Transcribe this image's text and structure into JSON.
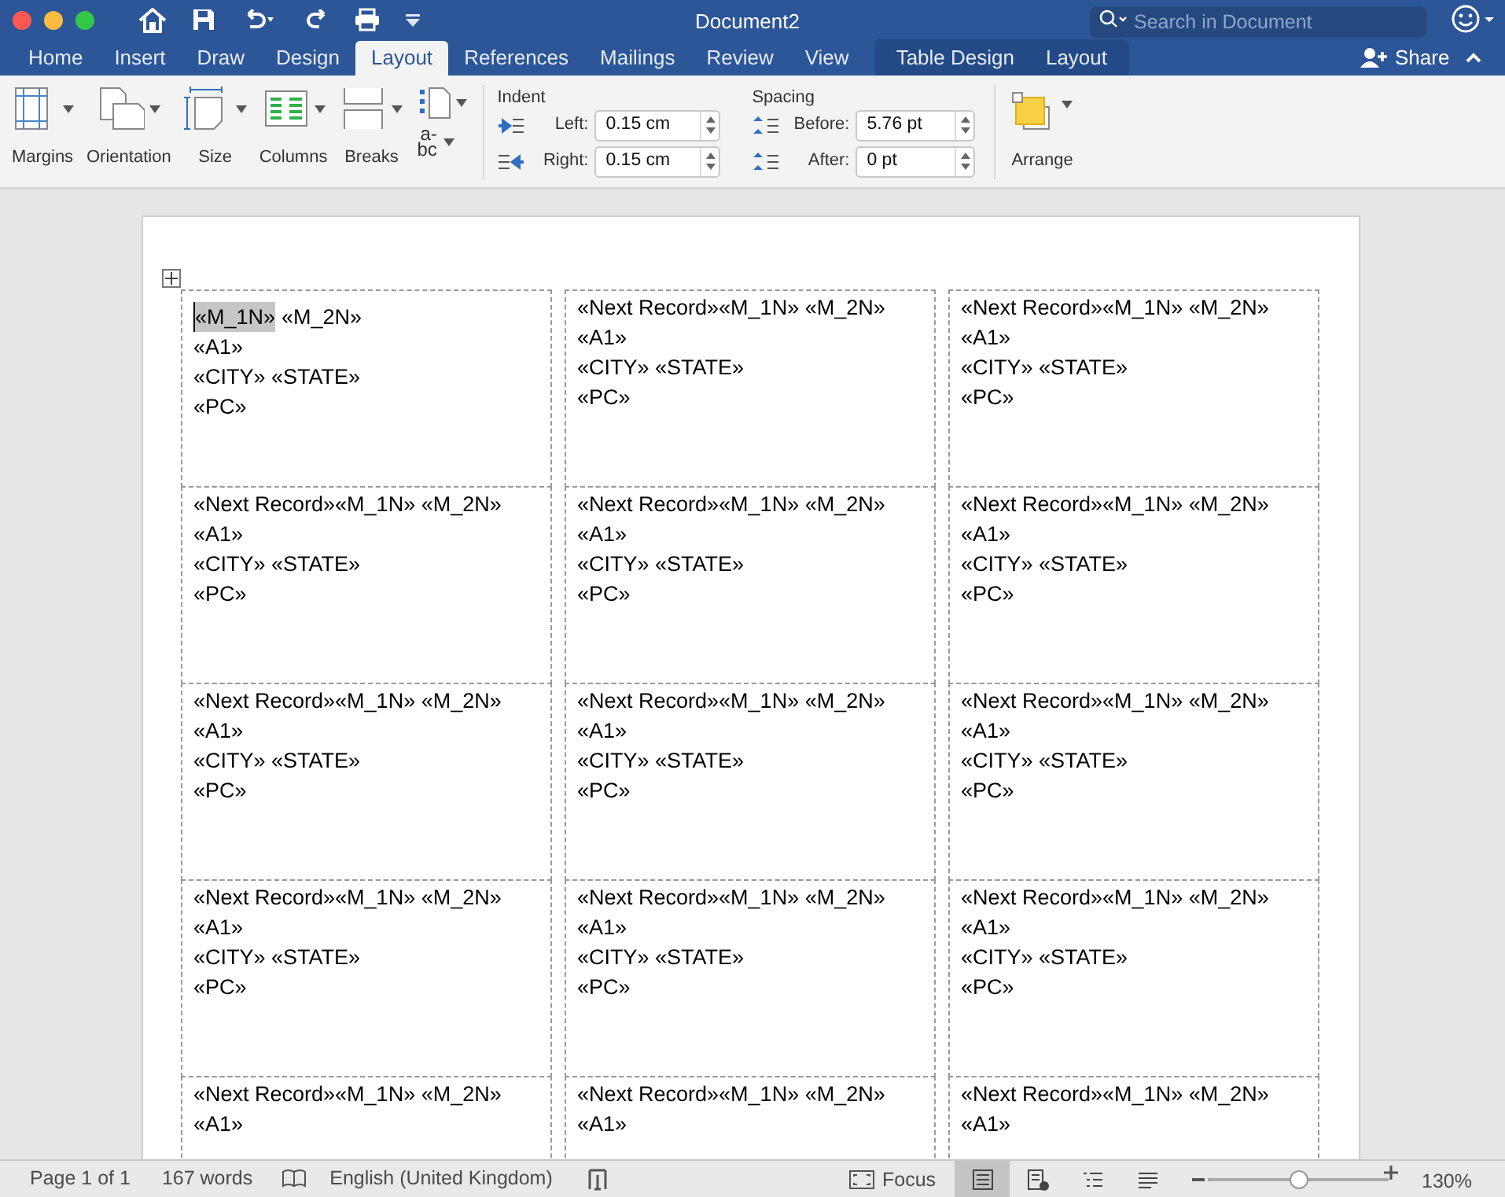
{
  "window": {
    "title": "Document2",
    "search": {
      "placeholder": "Search in Document"
    }
  },
  "tabs": [
    {
      "label": "Home",
      "selected": false,
      "contextual": false
    },
    {
      "label": "Insert",
      "selected": false,
      "contextual": false
    },
    {
      "label": "Draw",
      "selected": false,
      "contextual": false
    },
    {
      "label": "Design",
      "selected": false,
      "contextual": false
    },
    {
      "label": "Layout",
      "selected": true,
      "contextual": false
    },
    {
      "label": "References",
      "selected": false,
      "contextual": false
    },
    {
      "label": "Mailings",
      "selected": false,
      "contextual": false
    },
    {
      "label": "Review",
      "selected": false,
      "contextual": false
    },
    {
      "label": "View",
      "selected": false,
      "contextual": false
    },
    {
      "label": "Table Design",
      "selected": false,
      "contextual": true
    },
    {
      "label": "Layout",
      "selected": false,
      "contextual": true
    }
  ],
  "share": {
    "label": "Share"
  },
  "ribbon": {
    "buttons": [
      {
        "kind": "margins",
        "label": "Margins"
      },
      {
        "kind": "orientation",
        "label": "Orientation"
      },
      {
        "kind": "size",
        "label": "Size"
      },
      {
        "kind": "columns",
        "label": "Columns"
      },
      {
        "kind": "breaks",
        "label": "Breaks"
      }
    ],
    "hyphenation": {
      "top": "a-",
      "bottom": "bc"
    },
    "indent": {
      "title": "Indent",
      "fields": [
        {
          "label": "Left:",
          "value": "0.15 cm"
        },
        {
          "label": "Right:",
          "value": "0.15 cm"
        }
      ]
    },
    "spacing": {
      "title": "Spacing",
      "fields": [
        {
          "label": "Before:",
          "value": "5.76 pt"
        },
        {
          "label": "After:",
          "value": "0 pt"
        }
      ]
    },
    "arrange": {
      "label": "Arrange"
    }
  },
  "table": {
    "rows": [
      [
        {
          "selected_field": "«M_1N»",
          "lines": [
            "«M_2N»",
            "«A1»",
            "«CITY» «STATE»",
            "«PC»"
          ]
        },
        {
          "lines": [
            "«Next Record»«M_1N» «M_2N»",
            "«A1»",
            "«CITY» «STATE»",
            "«PC»"
          ]
        },
        {
          "lines": [
            "«Next Record»«M_1N» «M_2N»",
            "«A1»",
            "«CITY» «STATE»",
            "«PC»"
          ]
        }
      ],
      [
        {
          "lines": [
            "«Next Record»«M_1N» «M_2N»",
            "«A1»",
            "«CITY» «STATE»",
            "«PC»"
          ]
        },
        {
          "lines": [
            "«Next Record»«M_1N» «M_2N»",
            "«A1»",
            "«CITY» «STATE»",
            "«PC»"
          ]
        },
        {
          "lines": [
            "«Next Record»«M_1N» «M_2N»",
            "«A1»",
            "«CITY» «STATE»",
            "«PC»"
          ]
        }
      ],
      [
        {
          "lines": [
            "«Next Record»«M_1N» «M_2N»",
            "«A1»",
            "«CITY» «STATE»",
            "«PC»"
          ]
        },
        {
          "lines": [
            "«Next Record»«M_1N» «M_2N»",
            "«A1»",
            "«CITY» «STATE»",
            "«PC»"
          ]
        },
        {
          "lines": [
            "«Next Record»«M_1N» «M_2N»",
            "«A1»",
            "«CITY» «STATE»",
            "«PC»"
          ]
        }
      ],
      [
        {
          "lines": [
            "«Next Record»«M_1N» «M_2N»",
            "«A1»",
            "«CITY» «STATE»",
            "«PC»"
          ]
        },
        {
          "lines": [
            "«Next Record»«M_1N» «M_2N»",
            "«A1»",
            "«CITY» «STATE»",
            "«PC»"
          ]
        },
        {
          "lines": [
            "«Next Record»«M_1N» «M_2N»",
            "«A1»",
            "«CITY» «STATE»",
            "«PC»"
          ]
        }
      ],
      [
        {
          "lines": [
            "«Next Record»«M_1N» «M_2N»",
            "«A1»"
          ]
        },
        {
          "lines": [
            "«Next Record»«M_1N» «M_2N»",
            "«A1»"
          ]
        },
        {
          "lines": [
            "«Next Record»«M_1N» «M_2N»",
            "«A1»"
          ]
        }
      ]
    ]
  },
  "status_bar": {
    "page": "Page 1 of 1",
    "words": "167 words",
    "language": "English (United Kingdom)",
    "focus": "Focus",
    "views": [
      {
        "kind": "print",
        "selected": true
      },
      {
        "kind": "web",
        "selected": false
      },
      {
        "kind": "outline",
        "selected": false
      },
      {
        "kind": "draft",
        "selected": false
      }
    ],
    "zoom": {
      "level": 0.5,
      "reading": "130%"
    }
  }
}
